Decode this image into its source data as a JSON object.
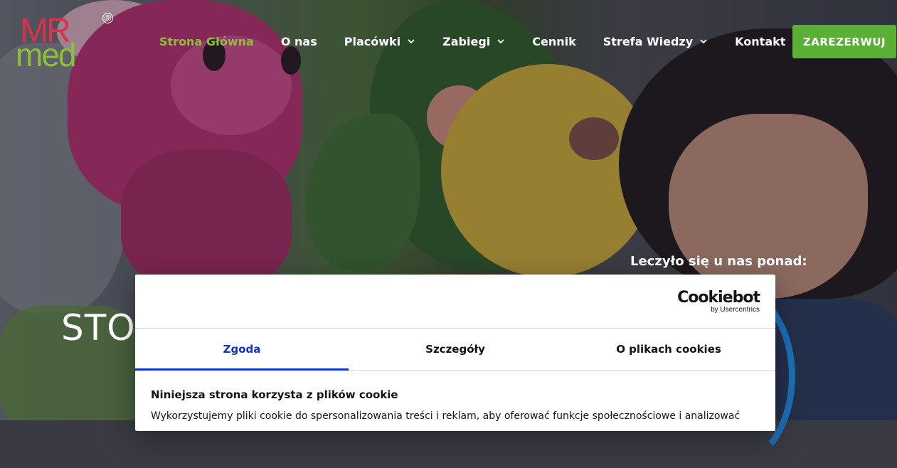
{
  "header": {
    "logo": {
      "top": "MR",
      "bottom": "med",
      "reg": "®"
    },
    "nav": [
      {
        "label": "Strona Główna",
        "active": true,
        "dropdown": false
      },
      {
        "label": "O nas",
        "active": false,
        "dropdown": false
      },
      {
        "label": "Placówki",
        "active": false,
        "dropdown": true
      },
      {
        "label": "Zabiegi",
        "active": false,
        "dropdown": true
      },
      {
        "label": "Cennik",
        "active": false,
        "dropdown": false
      },
      {
        "label": "Strefa Wiedzy",
        "active": false,
        "dropdown": true
      },
      {
        "label": "Kontakt",
        "active": false,
        "dropdown": false
      }
    ],
    "cta_label": "ZAREZERWUJ"
  },
  "hero": {
    "title": "STON",
    "counter_label": "Leczyło się u nas ponad:"
  },
  "cookie_dialog": {
    "brand": {
      "name": "Cookiebot",
      "sub": "by Usercentrics"
    },
    "tabs": [
      {
        "label": "Zgoda",
        "active": true
      },
      {
        "label": "Szczegóły",
        "active": false
      },
      {
        "label": "O plikach cookies",
        "active": false
      }
    ],
    "heading": "Niniejsza strona korzysta z plików cookie",
    "body": "Wykorzystujemy pliki cookie do spersonalizowania treści i reklam, aby oferować funkcje społecznościowe i analizować"
  },
  "colors": {
    "brand_green": "#8dbf3a",
    "brand_red": "#d9324e",
    "cta_green": "#5aaf35",
    "cookie_accent": "#1032cf"
  }
}
